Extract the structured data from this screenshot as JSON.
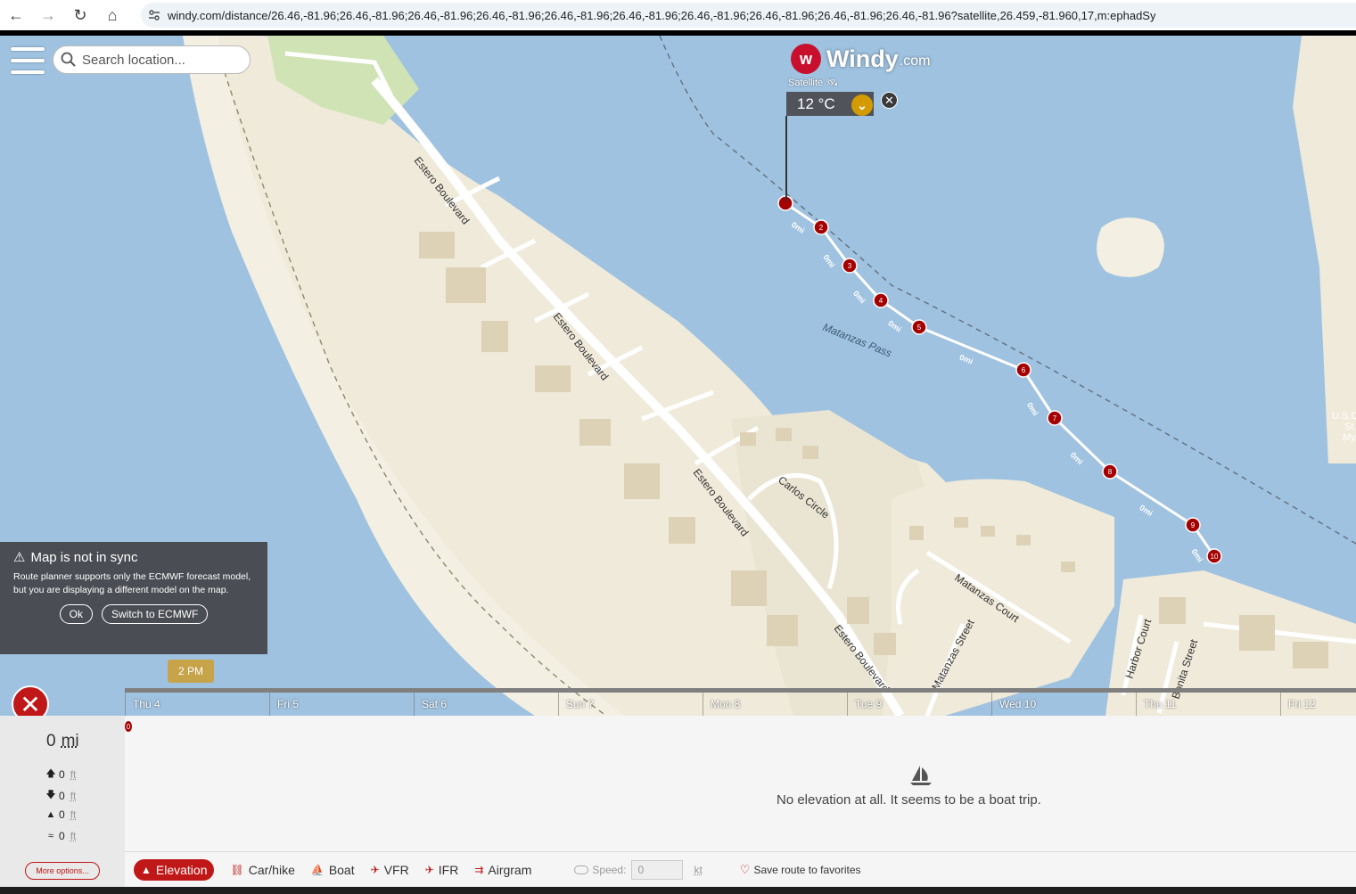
{
  "browser": {
    "url_host": "windy.com",
    "url_path": "/distance/26.46,-81.96;26.46,-81.96;26.46,-81.96;26.46,-81.96;26.46,-81.96;26.46,-81.96;26.46,-81.96;26.46,-81.96;26.46,-81.96;26.46,-81.96?satellite,26.459,-81.960,17,m:ephadSy"
  },
  "search": {
    "placeholder": "Search location..."
  },
  "logo": {
    "name": "Windy",
    "domain": ".com",
    "layer": "Satellite"
  },
  "temperature": {
    "value": "12 °C"
  },
  "map_labels": {
    "street1": "Estero Boulevard",
    "carlos": "Carlos Circle",
    "matanzas_pass": "Matanzas Pass",
    "matanzas_court": "Matanzas Court",
    "matanzas_street": "Matanzas Street",
    "harbor_court": "Harbor Court",
    "bonita_street": "Bonita Street",
    "usc": "U.S.C",
    "st": "St",
    "my": "My"
  },
  "route": {
    "markers": [
      "",
      "2",
      "3",
      "4",
      "5",
      "6",
      "7",
      "8",
      "9",
      "10"
    ],
    "segment_label": "0mi"
  },
  "sync_notice": {
    "title": "Map is not in sync",
    "text": "Route planner supports only the ECMWF forecast model, but you are displaying a different model on the map.",
    "ok": "Ok",
    "switch": "Switch to ECMWF"
  },
  "timeline": {
    "current": "2 PM",
    "days": [
      "Thu 4",
      "Fri 5",
      "Sat 6",
      "Sun 7",
      "Mon 8",
      "Tue 9",
      "Wed 10",
      "Thu 11",
      "Fri 12"
    ]
  },
  "stats": {
    "distance_value": "0",
    "distance_unit": "mi",
    "ascent": "0",
    "descent": "0",
    "max": "0",
    "avg": "0",
    "unit": "ft",
    "more_options": "More options..."
  },
  "chart": {
    "marker": "0",
    "message": "No elevation at all. It seems to be a boat trip."
  },
  "tabs": {
    "elevation": "Elevation",
    "carhike": "Car/hike",
    "boat": "Boat",
    "vfr": "VFR",
    "ifr": "IFR",
    "airgram": "Airgram"
  },
  "speed": {
    "label": "Speed:",
    "value": "0",
    "unit": "kt"
  },
  "favorites": "Save route to favorites",
  "colors": {
    "accent": "#c01818",
    "water": "#9fc2e0",
    "land": "#efeada",
    "route_marker": "#a40000"
  }
}
